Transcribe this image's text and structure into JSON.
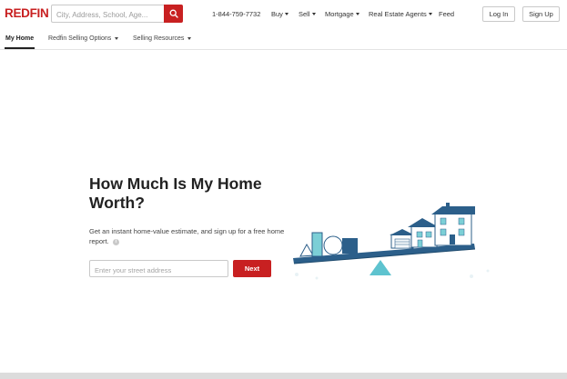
{
  "header": {
    "logo": "REDFIN",
    "search_placeholder": "City, Address, School, Age...",
    "phone": "1-844-759-7732",
    "nav": [
      {
        "label": "Buy",
        "has_dropdown": true
      },
      {
        "label": "Sell",
        "has_dropdown": true
      },
      {
        "label": "Mortgage",
        "has_dropdown": true
      },
      {
        "label": "Real Estate Agents",
        "has_dropdown": true
      },
      {
        "label": "Feed",
        "has_dropdown": false
      }
    ],
    "login_label": "Log In",
    "signup_label": "Sign Up",
    "icons": {
      "search": "search-icon"
    }
  },
  "subnav": {
    "tabs": [
      {
        "label": "My Home",
        "active": true
      },
      {
        "label": "Redfin Selling Options",
        "has_dropdown": true
      },
      {
        "label": "Selling Resources",
        "has_dropdown": true
      }
    ]
  },
  "hero": {
    "title": "How Much Is My Home Worth?",
    "subtitle": "Get an instant home-value estimate, and sign up for a free home report.",
    "address_placeholder": "Enter your street address",
    "next_label": "Next",
    "illustration": "scale-with-shapes-and-house"
  },
  "colors": {
    "brand_red": "#c82021",
    "text_dark": "#222222",
    "illustration_navy": "#2c5f8a",
    "illustration_teal": "#7ccfd6"
  }
}
